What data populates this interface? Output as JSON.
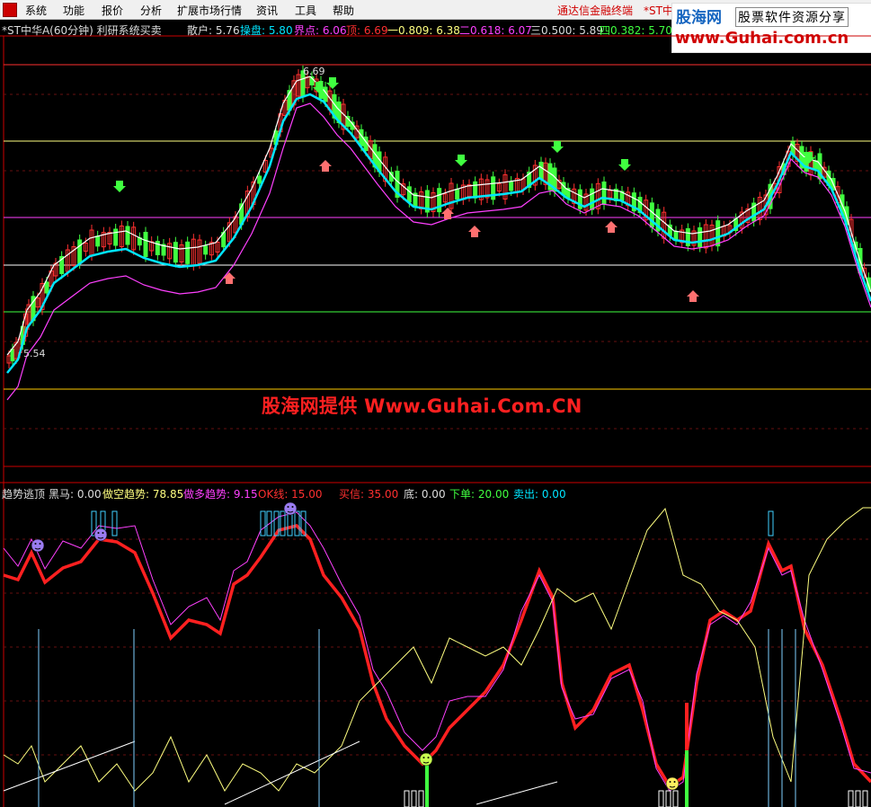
{
  "menu": [
    "系统",
    "功能",
    "报价",
    "分析",
    "扩展市场行情",
    "资讯",
    "工具",
    "帮助"
  ],
  "broker": "通达信金融终端",
  "stock_menu": "*ST中",
  "logo": {
    "name": "股海网",
    "slogan": "股票软件资源分享",
    "url": "www.Guhai.com.cn"
  },
  "main_title": "*ST中华A(60分钟) 利研系统买卖",
  "main_indicators": [
    {
      "label": "散户: 5.76",
      "color": "#dddddd"
    },
    {
      "label": "操盘: 5.80",
      "color": "#00e5ff"
    },
    {
      "label": "界点: 6.06",
      "color": "#ff40ff"
    },
    {
      "label": "顶: 6.69",
      "color": "#ff3030"
    },
    {
      "label": "一0.809: 6.38",
      "color": "#ffff80"
    },
    {
      "label": "二0.618: 6.07",
      "color": "#ff40ff"
    },
    {
      "label": "三0.500: 5.89",
      "color": "#dddddd"
    },
    {
      "label": "四0.382: 5.70",
      "color": "#40ff40"
    }
  ],
  "price_high": "6.69",
  "price_low": "5.54",
  "watermark": "股海网提供 Www.Guhai.Com.CN",
  "sub_indicators": [
    {
      "label": "趋势逃顶",
      "color": "#dddddd"
    },
    {
      "label": "黑马: 0.00",
      "color": "#dddddd"
    },
    {
      "label": "做空趋势: 78.85",
      "color": "#ffff80"
    },
    {
      "label": "做多趋势: 9.15",
      "color": "#ff40ff"
    },
    {
      "label": "OK线: 15.00",
      "color": "#ff3030"
    },
    {
      "label": "买信: 35.00",
      "color": "#ff3030"
    },
    {
      "label": "底: 0.00",
      "color": "#dddddd"
    },
    {
      "label": "下单: 20.00",
      "color": "#40ff40"
    },
    {
      "label": "卖出: 0.00",
      "color": "#00e5ff"
    }
  ],
  "colors": {
    "up": "#ff3030",
    "down": "#40ff40",
    "ma_fast": "#00e5ff",
    "ma_slow": "#ff40ff",
    "ma_white": "#ffffff",
    "red_line": "#ff2020"
  }
}
